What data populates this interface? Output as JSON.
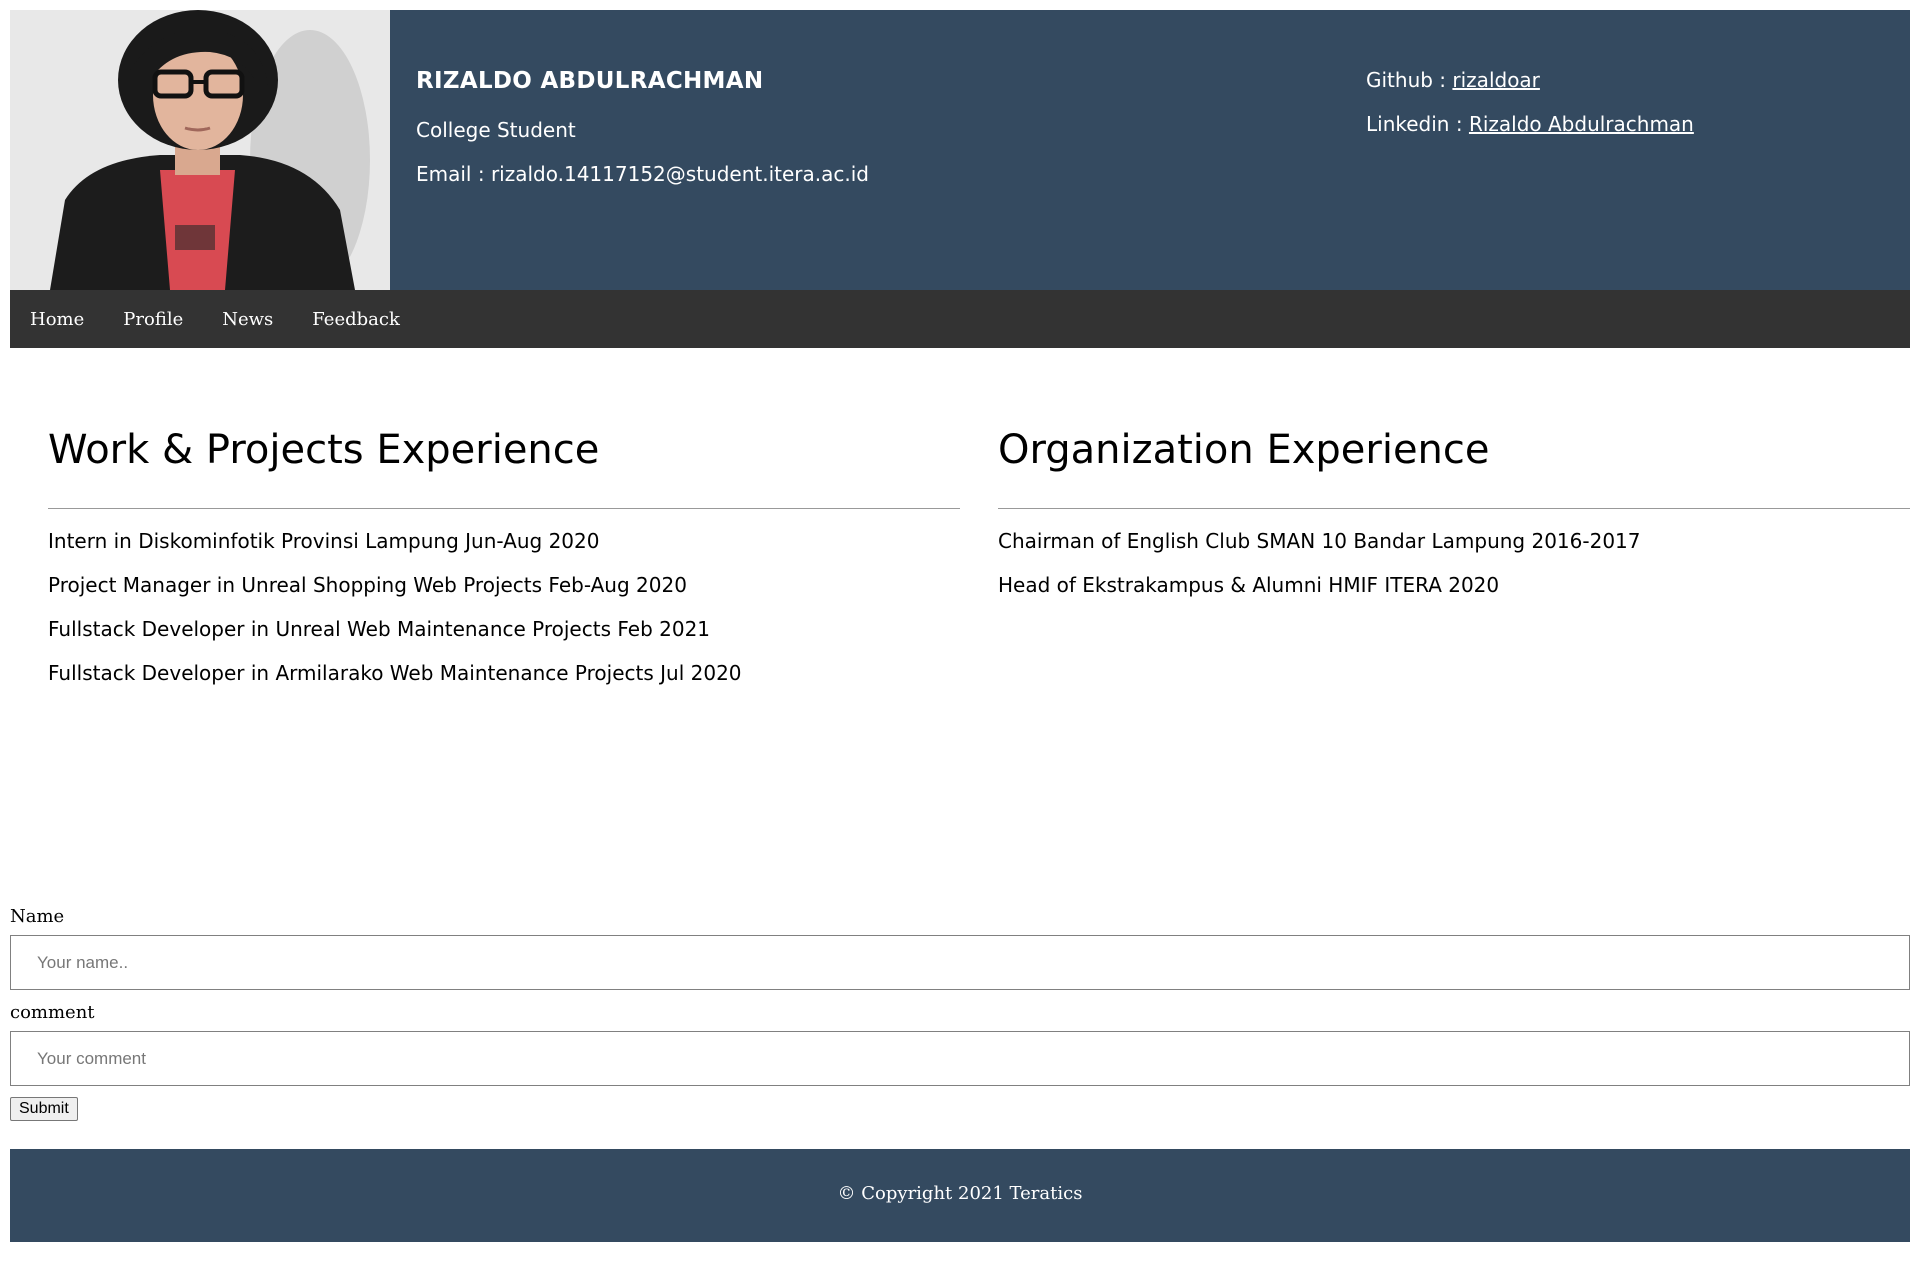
{
  "header": {
    "name": "RIZALDO ABDULRACHMAN",
    "role": "College Student",
    "email_label": "Email : ",
    "email": "rizaldo.14117152@student.itera.ac.id",
    "github_label": "Github : ",
    "github_link": "rizaldoar",
    "linkedin_label": "Linkedin : ",
    "linkedin_link": "Rizaldo Abdulrachman"
  },
  "nav": {
    "items": [
      "Home",
      "Profile",
      "News",
      "Feedback"
    ]
  },
  "work": {
    "title": "Work & Projects Experience",
    "items": [
      "Intern in Diskominfotik Provinsi Lampung Jun-Aug 2020",
      "Project Manager in Unreal Shopping Web Projects Feb-Aug 2020",
      "Fullstack Developer in Unreal Web Maintenance Projects Feb 2021",
      "Fullstack Developer in Armilarako Web Maintenance Projects Jul 2020"
    ]
  },
  "organization": {
    "title": "Organization Experience",
    "items": [
      "Chairman of English Club SMAN 10 Bandar Lampung 2016-2017",
      "Head of Ekstrakampus & Alumni HMIF ITERA 2020"
    ]
  },
  "form": {
    "name_label": "Name",
    "name_placeholder": "Your name..",
    "comment_label": "comment",
    "comment_placeholder": "Your comment",
    "submit_label": "Submit"
  },
  "footer": {
    "copyright": "© Copyright 2021 Teratics"
  },
  "colors": {
    "header_bg": "#344a60",
    "nav_bg": "#333333",
    "footer_bg": "#344a60"
  }
}
